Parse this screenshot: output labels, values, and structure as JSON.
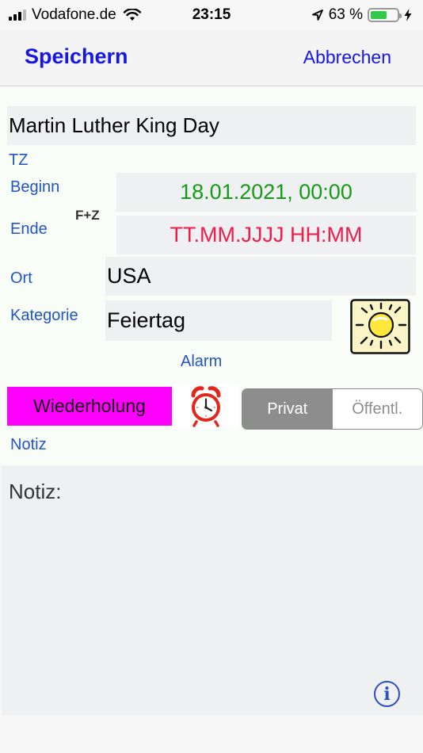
{
  "status": {
    "carrier": "Vodafone.de",
    "time": "23:15",
    "battery_percent": "63 %",
    "battery_level": 0.63,
    "battery_color": "#33c74b"
  },
  "nav": {
    "save_label": "Speichern",
    "cancel_label": "Abbrechen",
    "accent": "#1616e6"
  },
  "form": {
    "title_value": "Martin Luther King Day",
    "tz_label": "TZ",
    "begin_label": "Beginn",
    "begin_value": "18.01.2021, 00:00",
    "end_label": "Ende",
    "fz_label": "F+Z",
    "end_value": "TT.MM.JJJJ HH:MM",
    "location_label": "Ort",
    "location_value": "USA",
    "category_label": "Kategorie",
    "category_value": "Feiertag",
    "category_icon": "sun-icon",
    "alarm_label": "Alarm",
    "alarm_icon": "alarm-clock-icon",
    "repeat_label": "Wiederholung",
    "visibility": {
      "options": [
        "Privat",
        "Öffentl."
      ],
      "selected": "Privat"
    },
    "note_label": "Notiz"
  },
  "note": {
    "value": "Notiz:",
    "info_icon": "info-icon"
  },
  "colors": {
    "label": "#2254c4",
    "begin": "#179a17",
    "end": "#ee1d4c",
    "repeat_bg": "#ff00ff"
  }
}
